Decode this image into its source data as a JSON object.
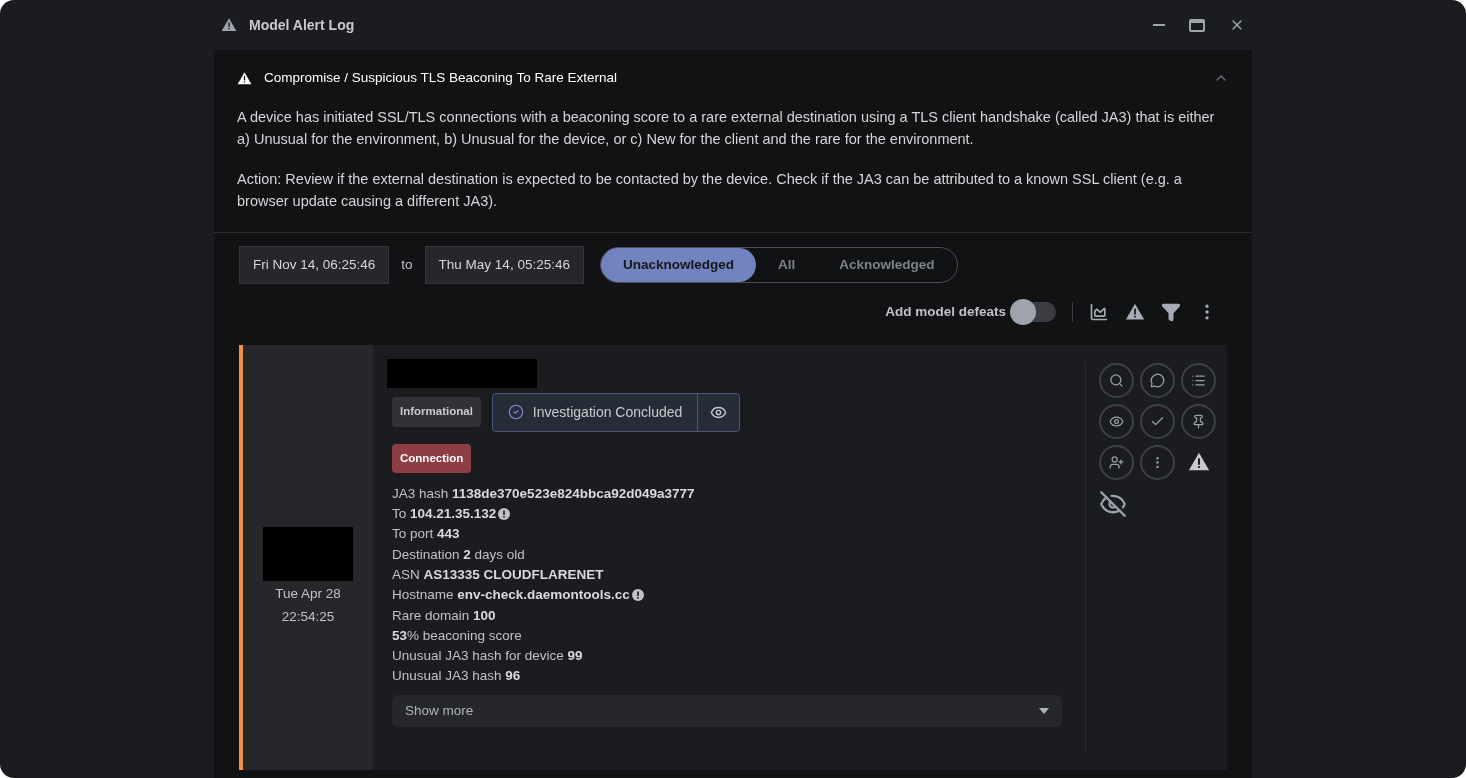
{
  "window": {
    "title": "Model Alert Log"
  },
  "model": {
    "name": "Compromise / Suspicious TLS Beaconing To Rare External",
    "expanded": true,
    "description": [
      "A device has initiated SSL/TLS connections with a beaconing score to a rare external destination using a TLS client handshake (called JA3) that is either a) Unusual for the environment, b) Unusual for the device, or c) New for the client and the rare for the environment.",
      "Action: Review if the external destination is expected to be contacted by the device. Check if the JA3 can be attributed to a known SSL client (e.g. a browser update causing a different JA3)."
    ]
  },
  "filters": {
    "from": "Fri Nov 14, 06:25:46",
    "separator": "to",
    "to": "Thu May 14, 05:25:46",
    "tabs": [
      {
        "label": "Unacknowledged",
        "selected": true
      },
      {
        "label": "All",
        "selected": false
      },
      {
        "label": "Acknowledged",
        "selected": false
      }
    ],
    "defeats_toggle": {
      "label": "Add model defeats",
      "on": false
    }
  },
  "alert": {
    "date": "Tue Apr 28",
    "time": "22:54:25",
    "priority": "Informational",
    "status": "Investigation Concluded",
    "tag": "Connection",
    "details": [
      "JA3 hash **1138de370e523e824bbca92d049a3777**",
      "To **104.21.35.132**",
      "To port **443**",
      "Destination **2** days old",
      "ASN **AS13335 CLOUDFLARENET**",
      "Hostname **env-check.daemontools.cc**",
      "Rare domain **100**",
      "**53**% beaconing score",
      "Unusual JA3 hash for device **99**",
      "Unusual JA3 hash **96**"
    ],
    "info_marks": [
      false,
      true,
      false,
      false,
      false,
      true,
      false,
      false,
      false,
      false
    ],
    "show_more": "Show more"
  }
}
